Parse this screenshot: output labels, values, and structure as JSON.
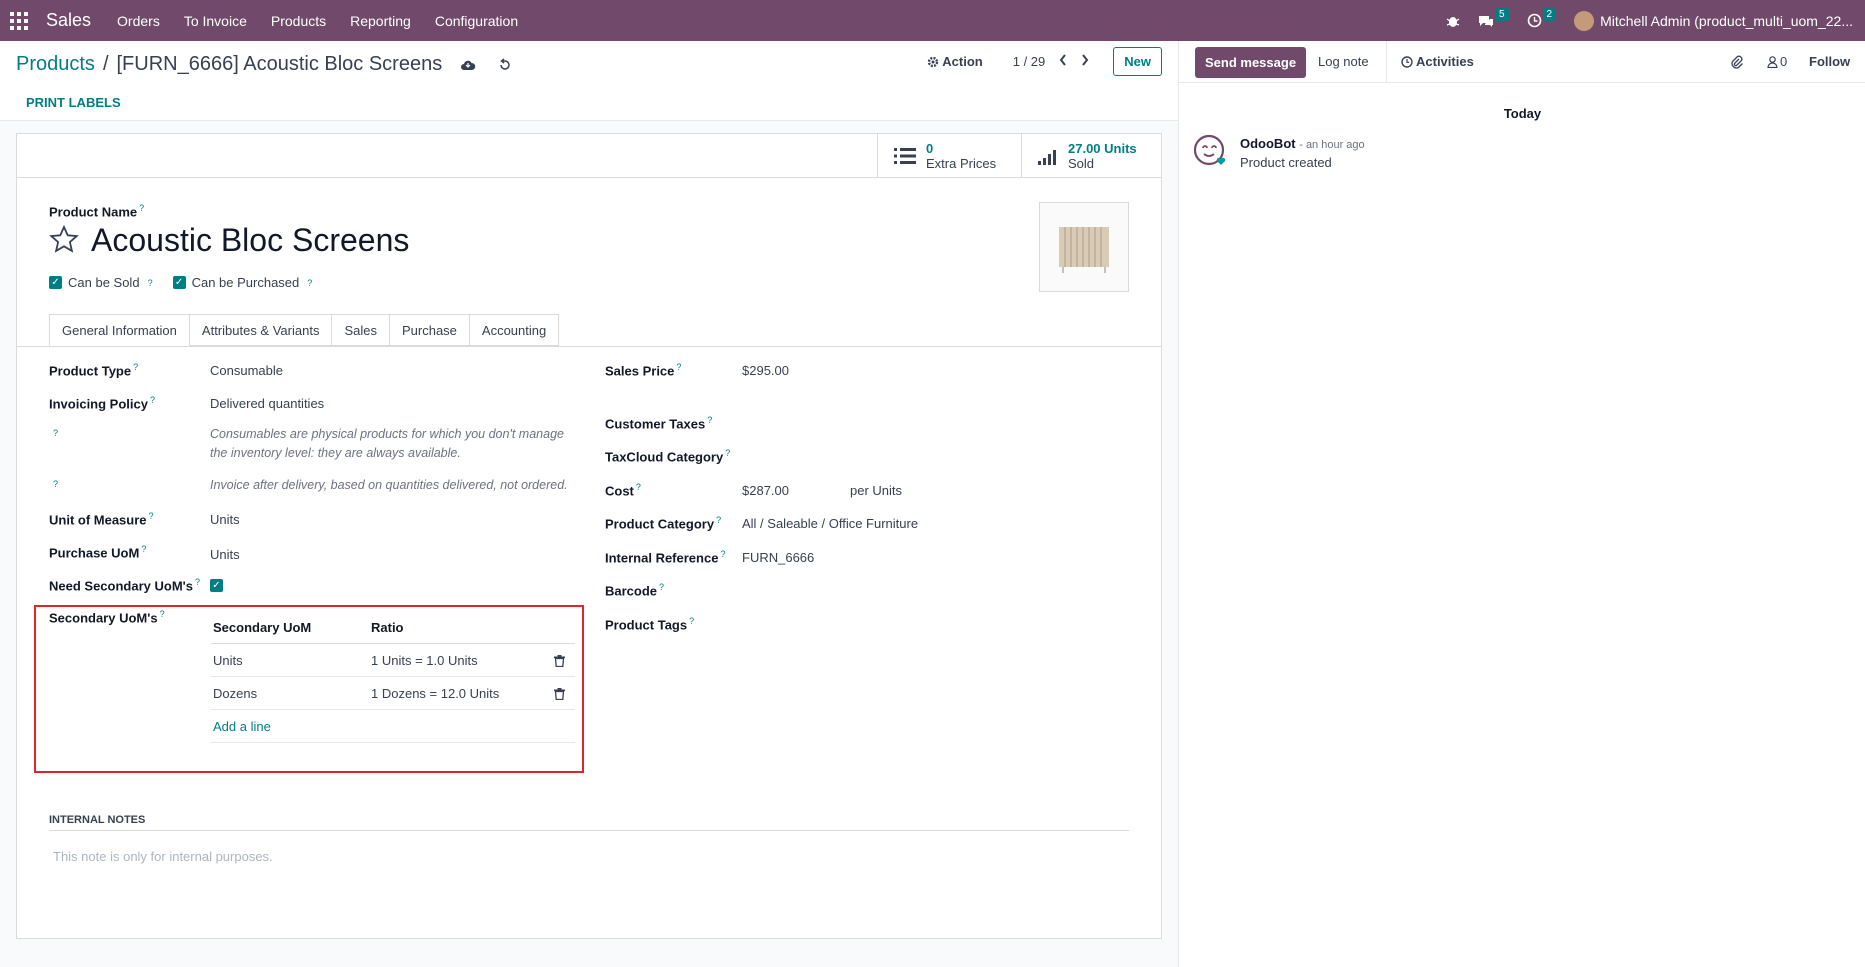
{
  "topbar": {
    "app_name": "Sales",
    "menu": [
      "Orders",
      "To Invoice",
      "Products",
      "Reporting",
      "Configuration"
    ],
    "messages_count": "5",
    "activities_count": "2",
    "user": "Mitchell Admin (product_multi_uom_22..."
  },
  "control_panel": {
    "breadcrumb_parent": "Products",
    "breadcrumb_sep": "/",
    "breadcrumb_current": "[FURN_6666] Acoustic Bloc Screens",
    "action_label": "Action",
    "pager": "1 / 29",
    "new_label": "New",
    "print_labels": "PRINT LABELS"
  },
  "stats": {
    "extra_prices_count": "0",
    "extra_prices_label": "Extra Prices",
    "sold_value": "27.00 Units",
    "sold_label": "Sold"
  },
  "product": {
    "name_label": "Product Name",
    "name": "Acoustic Bloc Screens",
    "can_be_sold": "Can be Sold",
    "can_be_purchased": "Can be Purchased"
  },
  "tabs": [
    "General Information",
    "Attributes & Variants",
    "Sales",
    "Purchase",
    "Accounting"
  ],
  "general": {
    "product_type_label": "Product Type",
    "product_type": "Consumable",
    "invoicing_policy_label": "Invoicing Policy",
    "invoicing_policy": "Delivered quantities",
    "consumable_help_1": "Consumables are physical products for which you don't manage",
    "consumable_help_2": "the inventory level: they are always available.",
    "invoice_help": "Invoice after delivery, based on quantities delivered, not ordered.",
    "uom_label": "Unit of Measure",
    "uom": "Units",
    "purchase_uom_label": "Purchase UoM",
    "purchase_uom": "Units",
    "need_secondary_label": "Need Secondary UoM's",
    "secondary_label": "Secondary UoM's",
    "sales_price_label": "Sales Price",
    "sales_price": "$295.00",
    "customer_taxes_label": "Customer Taxes",
    "taxcloud_label": "TaxCloud Category",
    "cost_label": "Cost",
    "cost": "$287.00",
    "cost_per": "per Units",
    "category_label": "Product Category",
    "category": "All / Saleable / Office Furniture",
    "internal_ref_label": "Internal Reference",
    "internal_ref": "FURN_6666",
    "barcode_label": "Barcode",
    "tags_label": "Product Tags"
  },
  "secondary_table": {
    "headers": [
      "Secondary UoM",
      "Ratio"
    ],
    "rows": [
      {
        "uom": "Units",
        "ratio": "1 Units = 1.0 Units"
      },
      {
        "uom": "Dozens",
        "ratio": "1 Dozens = 12.0 Units"
      }
    ],
    "add_line": "Add a line"
  },
  "notes": {
    "title": "INTERNAL NOTES",
    "placeholder": "This note is only for internal purposes."
  },
  "chatter": {
    "send_message": "Send message",
    "log_note": "Log note",
    "activities": "Activities",
    "followers_count": "0",
    "follow": "Follow",
    "day": "Today",
    "author": "OdooBot",
    "time": "- an hour ago",
    "message": "Product created"
  },
  "colors": {
    "brand": "#71496a",
    "accent": "#017e84",
    "highlight": "#e0242b"
  }
}
